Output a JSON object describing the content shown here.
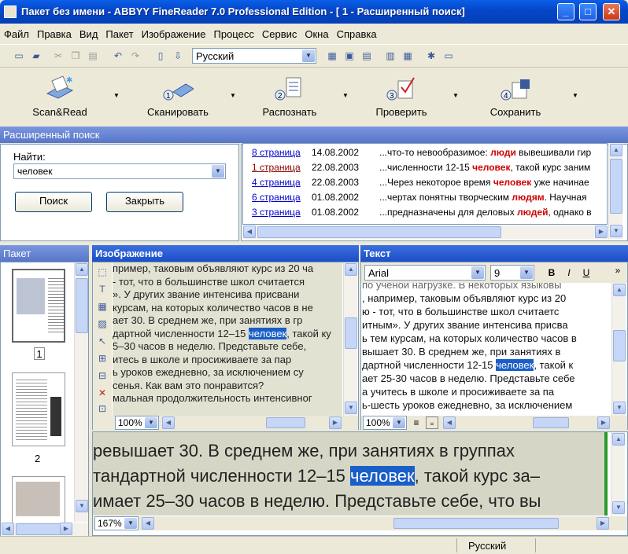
{
  "window": {
    "title": "Пакет без имени - ABBYY FineReader 7.0 Professional Edition - [ 1 - Расширенный поиск]"
  },
  "menu": [
    "Файл",
    "Правка",
    "Вид",
    "Пакет",
    "Изображение",
    "Процесс",
    "Сервис",
    "Окна",
    "Справка"
  ],
  "toolbar": {
    "language": "Русский"
  },
  "main_buttons": [
    "Scan&Read",
    "Сканировать",
    "Распознать",
    "Проверить",
    "Сохранить"
  ],
  "search": {
    "header": "Расширенный поиск",
    "find_label": "Найти:",
    "query": "человек",
    "search_button": "Поиск",
    "close_button": "Закрыть",
    "results": [
      {
        "page": "8 страница",
        "date": "14.08.2002",
        "pre": "...что-то невообразимое: ",
        "hit": "люди",
        "post": " вывешивали гир"
      },
      {
        "page": "1 страница",
        "date": "22.08.2003",
        "pre": "...численности 12-15 ",
        "hit": "человек",
        "post": ", такой курс заним"
      },
      {
        "page": "4 страница",
        "date": "22.08.2003",
        "pre": "...Через некоторое время ",
        "hit": "человек",
        "post": " уже начинае"
      },
      {
        "page": "6 страница",
        "date": "01.08.2002",
        "pre": "...чертах понятны творческим ",
        "hit": "людям",
        "post": ". Научная"
      },
      {
        "page": "3 страница",
        "date": "01.08.2002",
        "pre": "...предназначены для деловых ",
        "hit": "людей",
        "post": ", однако в"
      }
    ]
  },
  "batch": {
    "header": "Пакет",
    "pages": [
      "1",
      "2"
    ]
  },
  "image": {
    "header": "Изображение",
    "zoom": "100%",
    "lines": [
      "примeр, таковым объявляют курс из 20 ча",
      "- тот, что в большинстве школ считается",
      "». У других звание интенсива присвани",
      "курсам, на которых количество часов в не",
      "ает 30. В среднем же, при занятиях в гр",
      "дартной численности 12–15 ",
      "5–30 часов в неделю. Представьте себе,",
      "итесь в школе и просиживаете за пар",
      "ь уроков ежедневно, за исключением су",
      "сенья. Как вам это понравится?",
      "мальная продолжительность интенсивног"
    ],
    "selected_word": "человек",
    "line5_post": ", такой ку"
  },
  "text": {
    "header": "Текст",
    "font": "Arial",
    "size": "9",
    "zoom": "100%",
    "lines": [
      "по ученой нагрузке. В некоторых языковы",
      ", например, таковым объявляют курс из 20",
      "ю - тот, что в большинстве школ считаетс",
      "итным». У других звание интенсива присва",
      "ь тем курсам, на которых количество часов в",
      "вышает 30. В среднем же, при занятиях в",
      "дартной численности 12-15 ",
      "ает 25-30 часов в неделю. Представьте себе",
      "а учитесь в школе и просиживаете за па",
      "ь-шесть уроков ежедневно, за исключением"
    ],
    "line6_post": ", такой к"
  },
  "zoomview": {
    "zoom": "167%",
    "line1": "ревышает 30. В среднем же, при занятиях в группах",
    "line2_pre": "тандартной численности 12–15 ",
    "line2_post": ", такой курс за–",
    "line3": "имает 25–30 часов в неделю. Представьте себе, что вы"
  },
  "status": {
    "language": "Русский"
  }
}
